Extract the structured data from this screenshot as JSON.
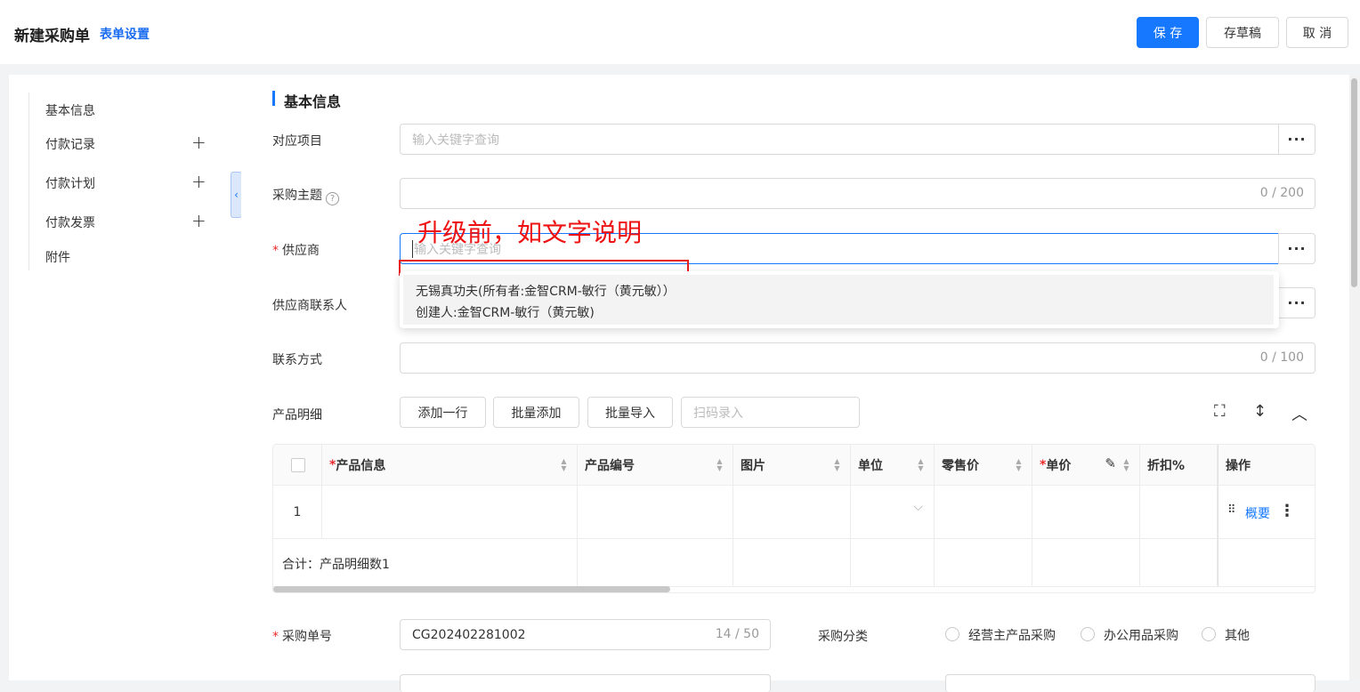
{
  "header": {
    "title": "新建采购单",
    "form_settings": "表单设置",
    "save": "保 存",
    "draft": "存草稿",
    "cancel": "取 消"
  },
  "sidebar": {
    "items": [
      {
        "label": "基本信息",
        "plus": false
      },
      {
        "label": "付款记录",
        "plus": true
      },
      {
        "label": "付款计划",
        "plus": true
      },
      {
        "label": "付款发票",
        "plus": true
      },
      {
        "label": "附件",
        "plus": false
      }
    ],
    "plus_glyph": "+",
    "collapse_glyph": "‹"
  },
  "section": {
    "title": "基本信息"
  },
  "fields": {
    "project": {
      "label": "对应项目",
      "placeholder": "输入关键字查询"
    },
    "subject": {
      "label": "采购主题",
      "counter": "0 / 200",
      "help": "?"
    },
    "supplier": {
      "label": "供应商",
      "placeholder": "输入关键字查询"
    },
    "contact": {
      "label": "供应商联系人"
    },
    "phone": {
      "label": "联系方式",
      "counter": "0 / 100"
    },
    "products_label": "产品明细",
    "order_no": {
      "label": "采购单号",
      "value": "CG202402281002",
      "counter": "14 / 50"
    },
    "category": {
      "label": "采购分类",
      "options": [
        "经营主产品采购",
        "办公用品采购",
        "其他"
      ]
    },
    "required_mark": "*",
    "more_glyph": "···"
  },
  "annotation": "升级前，如文字说明",
  "dropdown": {
    "line1": "无锡真功夫(所有者:金智CRM-敏行（黄元敏））",
    "line2": "创建人:金智CRM-敏行（黄元敏)"
  },
  "toolbar": {
    "add_row": "添加一行",
    "batch_add": "批量添加",
    "batch_import": "批量导入",
    "scan_placeholder": "扫码录入",
    "fullscreen_icon": "⛶",
    "resize_icon": "↕",
    "collapse_icon": "︿"
  },
  "table": {
    "headers": {
      "product_info": "产品信息",
      "product_code": "产品编号",
      "image": "图片",
      "unit": "单位",
      "retail_price": "零售价",
      "unit_price": "单价",
      "discount": "折扣%",
      "actions": "操作"
    },
    "row_index": "1",
    "summary_row": "合计：产品明细数1",
    "overview_link": "概要",
    "drag_icon": "⠿",
    "more_icon": "⋮",
    "unit_chevron": "⌵",
    "edit_icon": "✎",
    "sort_glyph": "▲▼"
  }
}
